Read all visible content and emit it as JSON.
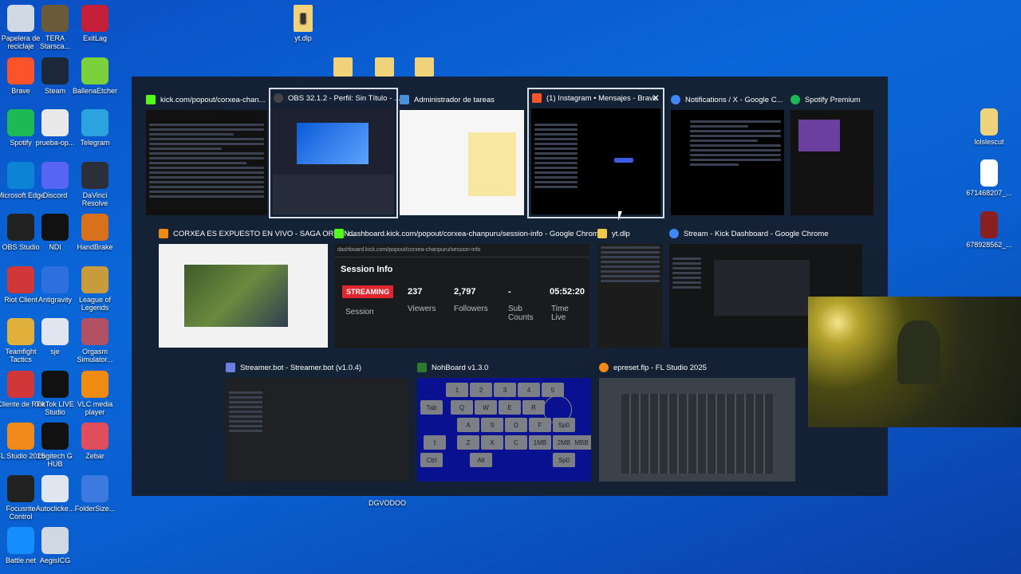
{
  "desktop": {
    "left_icons": [
      {
        "label": "Papelera de reciclaje",
        "icon": "recycle-bin-icon",
        "color": "#cfd8e3"
      },
      {
        "label": "TERA Starsca...",
        "icon": "tera-icon",
        "color": "#6b5a3a"
      },
      {
        "label": "ExitLag",
        "icon": "exitlag-icon",
        "color": "#c4203a"
      },
      {
        "label": "Brave",
        "icon": "brave-icon",
        "color": "#fb542b"
      },
      {
        "label": "Steam",
        "icon": "steam-icon",
        "color": "#1b2838"
      },
      {
        "label": "BallenaEtcher",
        "icon": "balena-icon",
        "color": "#7ad13b"
      },
      {
        "label": "Spotify",
        "icon": "spotify-icon",
        "color": "#1db954"
      },
      {
        "label": "prueba-op...",
        "icon": "document-icon",
        "color": "#e8e8e8"
      },
      {
        "label": "Telegram",
        "icon": "telegram-icon",
        "color": "#2aa3df"
      },
      {
        "label": "Microsoft Edge",
        "icon": "edge-icon",
        "color": "#0c83d4"
      },
      {
        "label": "Discord",
        "icon": "discord-icon",
        "color": "#5865f2"
      },
      {
        "label": "DaVinci Resolve",
        "icon": "davinci-icon",
        "color": "#2a2f3a"
      },
      {
        "label": "OBS Studio",
        "icon": "obs-icon",
        "color": "#222"
      },
      {
        "label": "NDI",
        "icon": "ndi-icon",
        "color": "#111"
      },
      {
        "label": "HandBrake",
        "icon": "handbrake-icon",
        "color": "#d8701c"
      },
      {
        "label": "Riot Client",
        "icon": "riot-icon",
        "color": "#d13639"
      },
      {
        "label": "Antigravity",
        "icon": "antigravity-icon",
        "color": "#2e6fe0"
      },
      {
        "label": "League of Legends",
        "icon": "lol-icon",
        "color": "#c89b3c"
      },
      {
        "label": "Teamfight Tactics",
        "icon": "tft-icon",
        "color": "#e0b03a"
      },
      {
        "label": "sje",
        "icon": "media-file-icon",
        "color": "#dfe6f0"
      },
      {
        "label": "Orgasm Simulator...",
        "icon": "game-icon",
        "color": "#b25064"
      },
      {
        "label": "Cliente de Riot",
        "icon": "riot-icon",
        "color": "#d13639"
      },
      {
        "label": "TikTok LIVE Studio",
        "icon": "tiktok-icon",
        "color": "#111"
      },
      {
        "label": "VLC media player",
        "icon": "vlc-icon",
        "color": "#f08b12"
      },
      {
        "label": "FL Studio 2025",
        "icon": "flstudio-icon",
        "color": "#f28a1a"
      },
      {
        "label": "Logitech G HUB",
        "icon": "ghub-icon",
        "color": "#111"
      },
      {
        "label": "Zebar",
        "icon": "zebar-icon",
        "color": "#e04e5c"
      },
      {
        "label": "Focusrite Control",
        "icon": "focusrite-icon",
        "color": "#222"
      },
      {
        "label": "Autoclicke...",
        "icon": "autoclicker-icon",
        "color": "#dfe6f0"
      },
      {
        "label": "FolderSize...",
        "icon": "foldersize-icon",
        "color": "#3d7ae0"
      },
      {
        "label": "Battle.net",
        "icon": "battlenet-icon",
        "color": "#148eff"
      },
      {
        "label": "AegisICG",
        "icon": "aegis-icon",
        "color": "#cfd8e3"
      }
    ],
    "top_icon_label": "yt.dlp",
    "right_icons": [
      {
        "label": "lolslescut",
        "icon": "folder-icon",
        "color": "#f0d27a"
      },
      {
        "label": "671468207_...",
        "icon": "white-file-icon",
        "color": "#fff"
      },
      {
        "label": "678928562_...",
        "icon": "image-file-icon",
        "color": "#8a1f1f"
      }
    ],
    "bottom_label": "DGVODOO"
  },
  "switcher": {
    "windows": [
      {
        "title": "kick.com/popout/corxea-chan...",
        "icon": "kick-icon",
        "color": "#53fc18"
      },
      {
        "title": "OBS 32.1.2 - Perfil: Sin Título - ...",
        "icon": "obs-icon",
        "color": "#444"
      },
      {
        "title": "Administrador de tareas",
        "icon": "taskmanager-icon",
        "color": "#4a90d9"
      },
      {
        "title": "(1) Instagram • Mensajes - Brave",
        "icon": "brave-icon",
        "color": "#fb542b"
      },
      {
        "title": "Notifications / X - Google C...",
        "icon": "chrome-icon",
        "color": "#4285f4"
      },
      {
        "title": "Spotify Premium",
        "icon": "spotify-icon",
        "color": "#1db954"
      },
      {
        "title": "CORXEA ES EXPUESTO EN VIVO - SAGA ORIGIN...",
        "icon": "vlc-icon",
        "color": "#f08b12"
      },
      {
        "title": "dashboard.kick.com/popout/corxea-chanpuru/session-info - Google Chrome",
        "icon": "kick-icon",
        "color": "#53fc18"
      },
      {
        "title": "yt.dlp",
        "icon": "folder-icon",
        "color": "#f0c94a"
      },
      {
        "title": "Stream - Kick Dashboard - Google Chrome",
        "icon": "chrome-icon",
        "color": "#4285f4"
      },
      {
        "title": "Streamer.bot - Streamer.bot (v1.0.4)",
        "icon": "streamerbot-icon",
        "color": "#6b7fe0"
      },
      {
        "title": "NohBoard v1.3.0",
        "icon": "nohboard-icon",
        "color": "#2d7a2d"
      },
      {
        "title": "epreset.flp - FL Studio 2025",
        "icon": "flstudio-icon",
        "color": "#f28a1a"
      }
    ],
    "close_glyph": "✕"
  },
  "session_info": {
    "url": "dashboard.kick.com/popout/corxea-chanpuru/session-info",
    "heading": "Session Info",
    "status_badge": "STREAMING",
    "status_label": "Session",
    "viewers_value": "237",
    "viewers_label": "Viewers",
    "followers_value": "2,797",
    "followers_label": "Followers",
    "subs_value": "-",
    "subs_label": "Sub Counts",
    "time_value": "05:52:20",
    "time_label": "Time Live"
  },
  "nohboard": {
    "keys": [
      "1",
      "2",
      "3",
      "4",
      "5",
      "Tab",
      "Q",
      "W",
      "E",
      "R",
      "A",
      "S",
      "D",
      "F",
      "⇧",
      "Z",
      "X",
      "C",
      "V",
      "Ctrl",
      "Alt",
      "Sp0",
      "1MB",
      "2MB",
      "MBB",
      "Sp0"
    ],
    "color": "#0a1190"
  },
  "colors": {
    "accent": "#53fc18",
    "streaming": "#e0262f"
  }
}
